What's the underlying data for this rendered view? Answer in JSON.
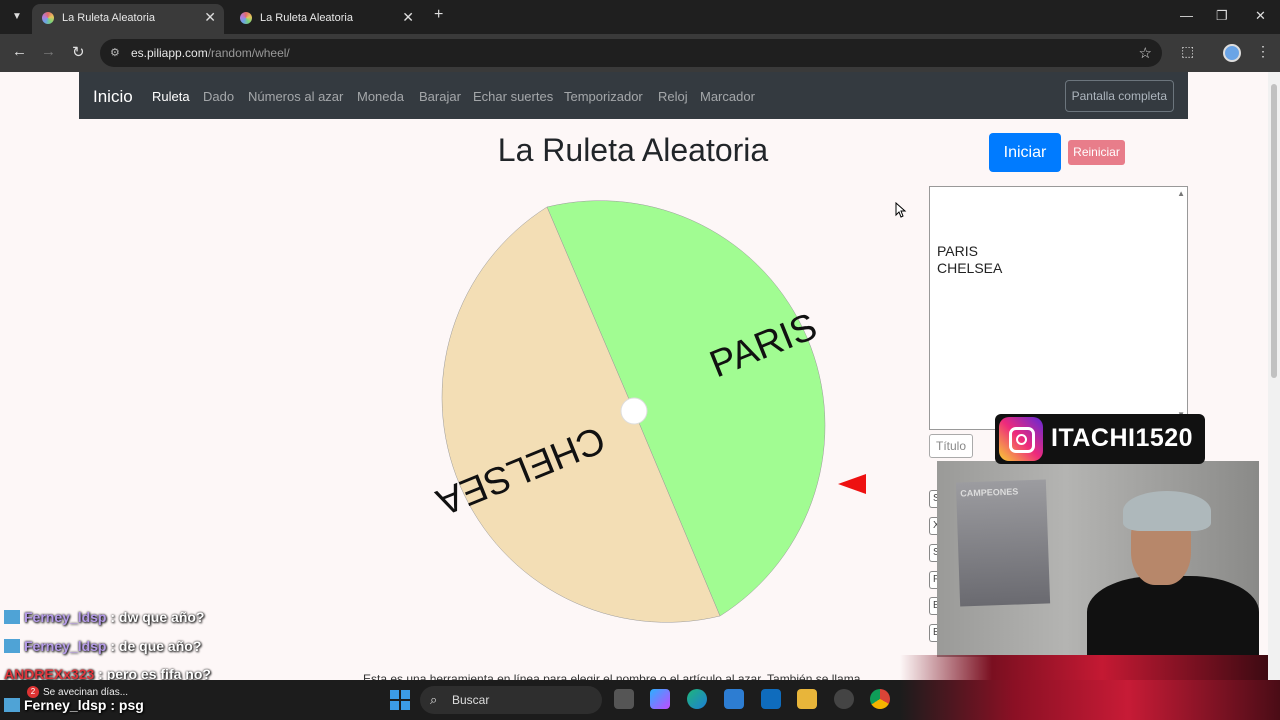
{
  "browser": {
    "tabs": [
      {
        "title": "La Ruleta Aleatoria",
        "active": true
      },
      {
        "title": "La Ruleta Aleatoria",
        "active": false
      }
    ],
    "url_domain": "es.piliapp.com",
    "url_path": "/random/wheel/"
  },
  "navbar": {
    "brand": "Inicio",
    "links": [
      "Ruleta",
      "Dado",
      "Números al azar",
      "Moneda",
      "Barajar",
      "Echar suertes",
      "Temporizador",
      "Reloj",
      "Marcador"
    ],
    "active_link": "Ruleta",
    "fullscreen_label": "Pantalla completa"
  },
  "page": {
    "title": "La Ruleta Aleatoria",
    "start_label": "Iniciar",
    "reset_label": "Reiniciar",
    "entries": [
      "PARIS",
      "CHELSEA"
    ],
    "title_placeholder": "Título",
    "side_button_letters": [
      "S",
      "X",
      "S",
      "F",
      "E",
      "E"
    ],
    "description": "Esta es una herramienta en línea para elegir el nombre o el artículo al azar. También se llama"
  },
  "wheel": {
    "segments": [
      {
        "label": "PARIS",
        "color": "#a1fc92"
      },
      {
        "label": "CHELSEA",
        "color": "#f3deb5"
      }
    ],
    "pointer_color": "#ee1111"
  },
  "overlay": {
    "instagram_handle": "ITACHI1520",
    "poster_text": "CAMPEONES",
    "chat": [
      {
        "user": "Ferney_ldsp",
        "message": ": dw que año?",
        "color": "purple"
      },
      {
        "user": "Ferney_ldsp",
        "message": ": de que año?",
        "color": "purple"
      },
      {
        "user": "ANDREXx323",
        "message": ": pero es fifa no?",
        "color": "red"
      },
      {
        "user": "Ferney_ldsp",
        "message": ": psg",
        "color": "purple"
      }
    ]
  },
  "taskbar": {
    "notification": "Se avecinan días...",
    "notification_count": "2",
    "search_label": "Buscar"
  }
}
